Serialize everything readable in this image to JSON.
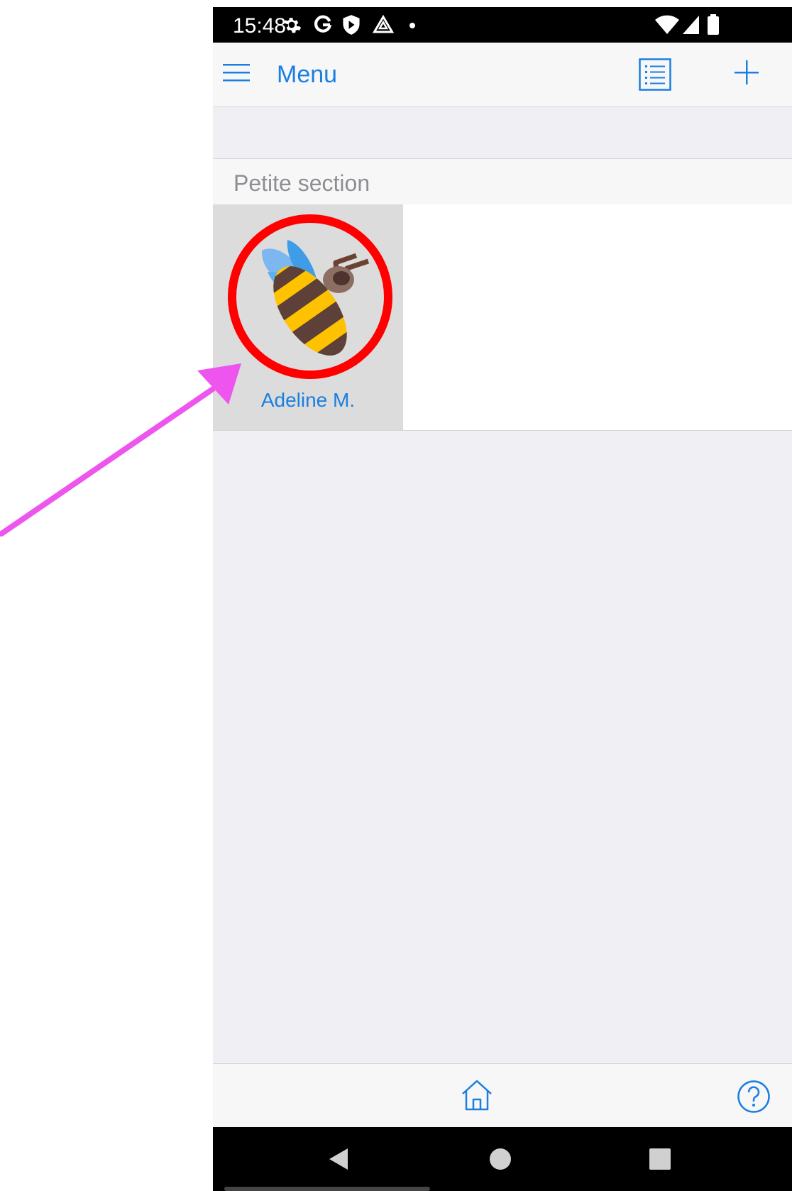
{
  "status_bar": {
    "time": "15:48",
    "left_icons": [
      "gear-icon",
      "google-g-icon",
      "shield-play-icon",
      "triangle-warning-icon",
      "dot-icon"
    ],
    "right_icons": [
      "wifi-icon",
      "signal-icon",
      "battery-icon"
    ]
  },
  "nav_bar": {
    "menu_label": "Menu",
    "left_icon": "hamburger-icon",
    "right_icons": [
      "list-icon",
      "plus-icon"
    ],
    "accent_color": "#1a7fe0"
  },
  "section": {
    "title": "Petite section",
    "students": [
      {
        "name": "Adeline M.",
        "avatar": "bee-icon",
        "highlight_color": "#ff0000"
      }
    ]
  },
  "tab_bar": {
    "icons": [
      "home-icon",
      "help-icon"
    ]
  },
  "android_nav": {
    "icons": [
      "back-triangle-icon",
      "home-circle-icon",
      "recents-square-icon"
    ]
  },
  "annotation": {
    "arrow_color": "#ee55ee"
  }
}
